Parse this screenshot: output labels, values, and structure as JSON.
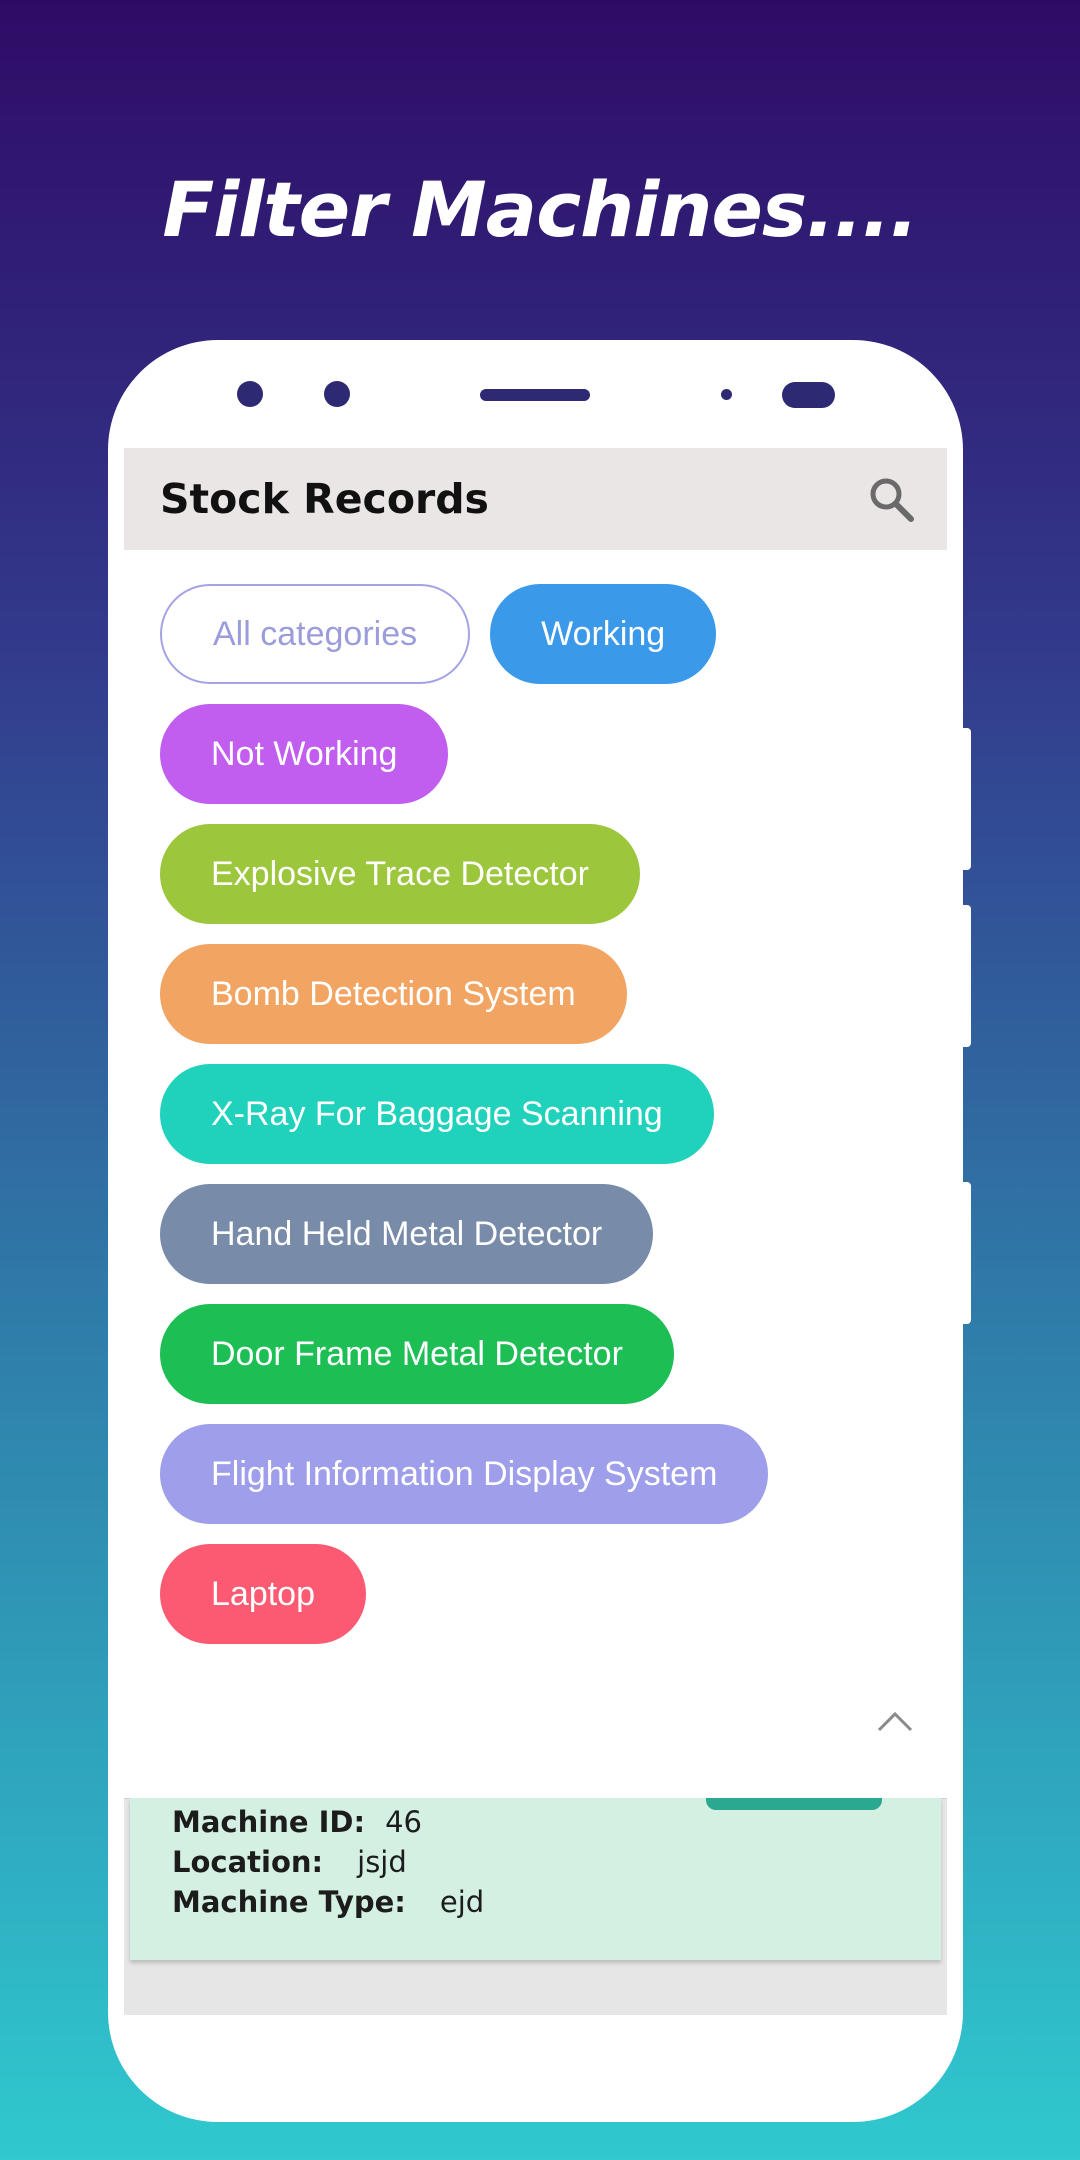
{
  "headline": "Filter Machines....",
  "appbar": {
    "title": "Stock Records",
    "search_icon": "search-icon"
  },
  "filters": {
    "rows": [
      [
        {
          "label": "All categories",
          "color": "#ffffff",
          "style": "outline"
        },
        {
          "label": "Working",
          "color": "#3b99ea"
        }
      ],
      [
        {
          "label": "Not Working",
          "color": "#c15ef0"
        }
      ],
      [
        {
          "label": "Explosive Trace Detector",
          "color": "#9cc63c"
        }
      ],
      [
        {
          "label": "Bomb Detection System",
          "color": "#f2a462"
        }
      ],
      [
        {
          "label": "X-Ray For Baggage Scanning",
          "color": "#20d2bb"
        }
      ],
      [
        {
          "label": "Hand Held Metal Detector",
          "color": "#788ba9"
        }
      ],
      [
        {
          "label": "Door Frame Metal Detector",
          "color": "#1dbf55"
        }
      ],
      [
        {
          "label": "Flight Information Display System",
          "color": "#9e9eea"
        }
      ],
      [
        {
          "label": "Laptop",
          "color": "#fb5a72"
        }
      ]
    ],
    "collapse_icon": "chevron-up-icon"
  },
  "record": {
    "machine_id_label": "Machine ID:",
    "machine_id": "46",
    "location_label": "Location:",
    "location": "jsjd",
    "machine_type_label": "Machine Type:",
    "machine_type": "ejd"
  }
}
